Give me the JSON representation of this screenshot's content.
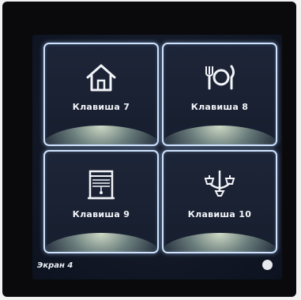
{
  "keys": [
    {
      "label": "Клавиша 7",
      "icon": "home-icon"
    },
    {
      "label": "Клавиша 8",
      "icon": "dining-icon"
    },
    {
      "label": "Клавиша 9",
      "icon": "window-blinds-icon"
    },
    {
      "label": "Клавиша 10",
      "icon": "chandelier-icon"
    }
  ],
  "footer": {
    "page_label": "Экран 4"
  },
  "colors": {
    "key_border": "#cfe3ff",
    "screen_bg": "#121826",
    "label_text": "#f2f4f8"
  }
}
